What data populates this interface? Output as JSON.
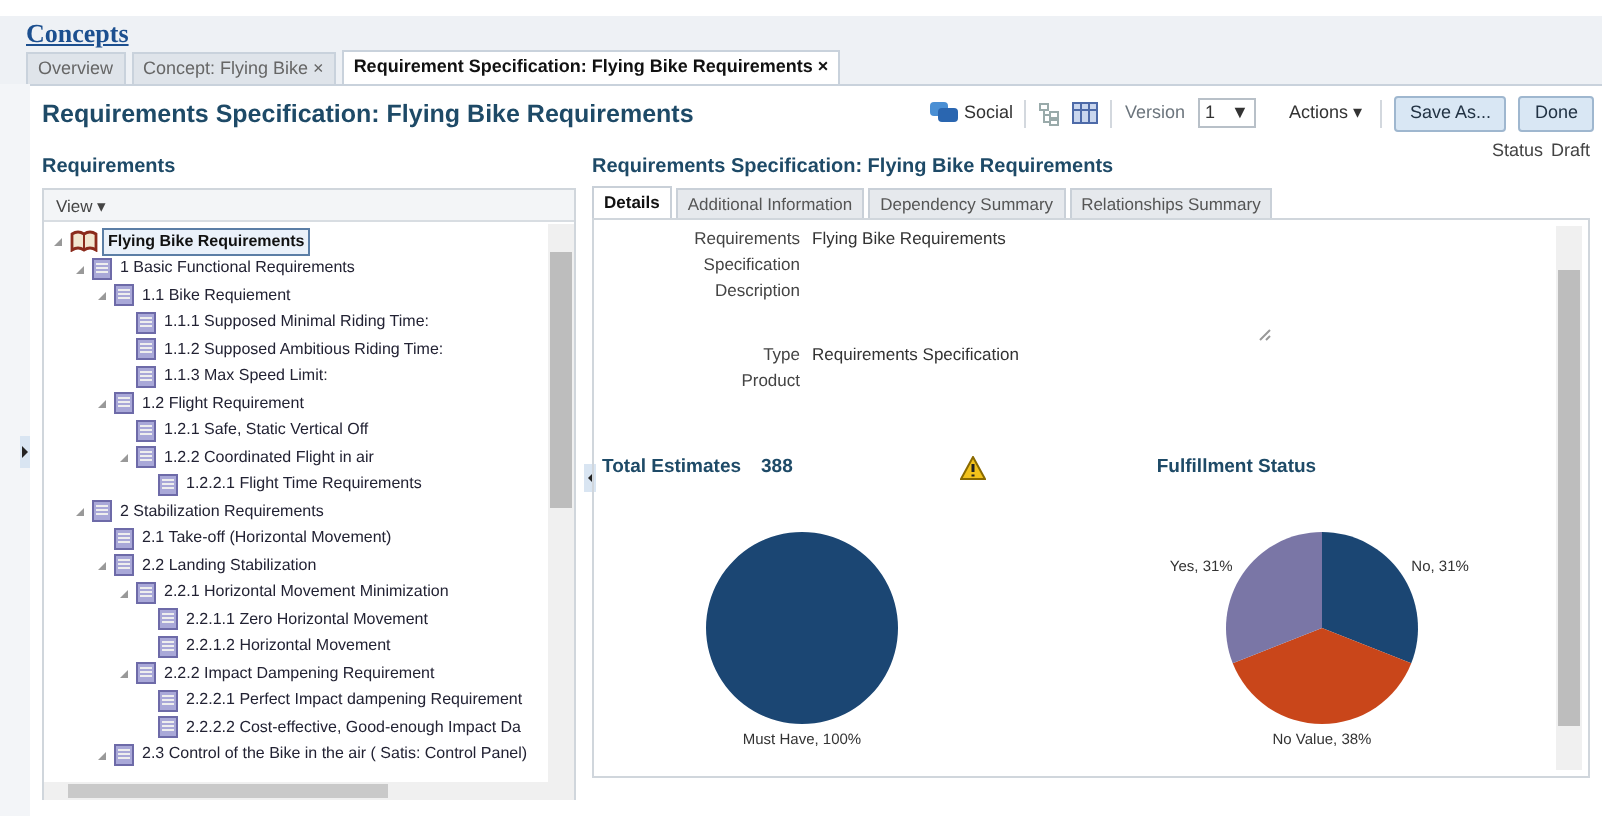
{
  "header": {
    "link": "Concepts"
  },
  "tabs": [
    {
      "label": "Overview",
      "selected": false
    },
    {
      "label": "Concept: Flying Bike",
      "close": "×",
      "selected": false
    },
    {
      "label": "Requirement Specification: Flying Bike Requirements",
      "close": "×",
      "selected": true
    }
  ],
  "page_title": "Requirements Specification: Flying Bike Requirements",
  "toolbar": {
    "social": "Social",
    "version_label": "Version",
    "version": "1",
    "version_caret": "▼",
    "actions": "Actions",
    "actions_caret": "▾",
    "buttons": [
      "Save As...",
      "Done"
    ]
  },
  "status": {
    "label": "Status",
    "value": "Draft"
  },
  "requirements": {
    "title": "Requirements",
    "view_menu": "View",
    "view_menu_caret": "▾",
    "tree": [
      {
        "label": "Flying Bike Requirements",
        "kind": "book",
        "selected": true,
        "expanded": true,
        "children": [
          {
            "label": "1 Basic Functional Requirements",
            "kind": "doc",
            "selected": false,
            "expanded": true,
            "children": [
              {
                "label": "1.1 Bike Requiement",
                "kind": "doc",
                "selected": false,
                "expanded": true,
                "children": [
                  {
                    "label": "1.1.1 Supposed Minimal Riding Time:",
                    "kind": "doc",
                    "selected": false
                  },
                  {
                    "label": "1.1.2 Supposed Ambitious Riding Time:",
                    "kind": "doc",
                    "selected": false
                  },
                  {
                    "label": "1.1.3 Max Speed Limit:",
                    "kind": "doc",
                    "selected": false
                  }
                ]
              },
              {
                "label": "1.2 Flight Requirement",
                "kind": "doc",
                "selected": false,
                "expanded": true,
                "children": [
                  {
                    "label": "1.2.1 Safe, Static Vertical Off",
                    "kind": "doc",
                    "selected": false
                  },
                  {
                    "label": "1.2.2 Coordinated Flight in air",
                    "kind": "doc",
                    "selected": false,
                    "expanded": true,
                    "children": [
                      {
                        "label": "1.2.2.1 Flight Time Requirements",
                        "kind": "doc",
                        "selected": false
                      }
                    ]
                  }
                ]
              }
            ]
          },
          {
            "label": "2 Stabilization Requirements",
            "kind": "doc",
            "selected": false,
            "expanded": true,
            "children": [
              {
                "label": "2.1 Take-off (Horizontal Movement)",
                "kind": "doc",
                "selected": false
              },
              {
                "label": "2.2 Landing Stabilization",
                "kind": "doc",
                "selected": false,
                "expanded": true,
                "children": [
                  {
                    "label": "2.2.1 Horizontal Movement Minimization",
                    "kind": "doc",
                    "selected": false,
                    "expanded": true,
                    "children": [
                      {
                        "label": "2.2.1.1 Zero Horizontal Movement",
                        "kind": "doc",
                        "selected": false
                      },
                      {
                        "label": "2.2.1.2 Horizontal Movement",
                        "kind": "doc",
                        "selected": false
                      }
                    ]
                  },
                  {
                    "label": "2.2.2 Impact Dampening Requirement",
                    "kind": "doc",
                    "selected": false,
                    "expanded": true,
                    "children": [
                      {
                        "label": "2.2.2.1 Perfect Impact dampening Requirement",
                        "kind": "doc",
                        "selected": false
                      },
                      {
                        "label": "2.2.2.2 Cost-effective, Good-enough Impact Da",
                        "kind": "doc",
                        "selected": false
                      }
                    ]
                  }
                ]
              },
              {
                "label": "2.3 Control of the Bike in the air ( Satis: Control Panel)",
                "kind": "doc",
                "selected": false,
                "expanded": true
              }
            ]
          }
        ]
      }
    ]
  },
  "detail": {
    "title": "Requirements Specification: Flying Bike Requirements",
    "tabs": [
      {
        "label": "Details",
        "selected": true
      },
      {
        "label": "Additional Information",
        "selected": false
      },
      {
        "label": "Dependency Summary",
        "selected": false
      },
      {
        "label": "Relationships Summary",
        "selected": false
      }
    ],
    "fields": [
      {
        "label": "Requirements Specification",
        "value": "Flying Bike Requirements",
        "kind": "text"
      },
      {
        "label": "Description",
        "kind": "textarea"
      },
      {
        "label": "Type",
        "value": "Requirements Specification",
        "kind": "text"
      },
      {
        "label": "Product",
        "kind": "text"
      }
    ],
    "estimates": {
      "label": "Total Estimates",
      "value": "388",
      "warning": true,
      "chart_data": {
        "type": "pie",
        "categories": [
          "Must Have"
        ],
        "values": [
          100
        ],
        "colors": [
          "#1b4673"
        ],
        "value_labels": [
          ", 100%"
        ]
      }
    },
    "fulfillment": {
      "title": "Fulfillment Status",
      "chart_data": {
        "type": "pie",
        "categories": [
          "No",
          "No Value",
          "Yes"
        ],
        "values": [
          31,
          38,
          31
        ],
        "colors": [
          "#1b4673",
          "#c9461a",
          "#7a76a6"
        ],
        "value_labels": [
          ", 31%",
          ", 38%",
          ", 31%"
        ]
      }
    }
  }
}
